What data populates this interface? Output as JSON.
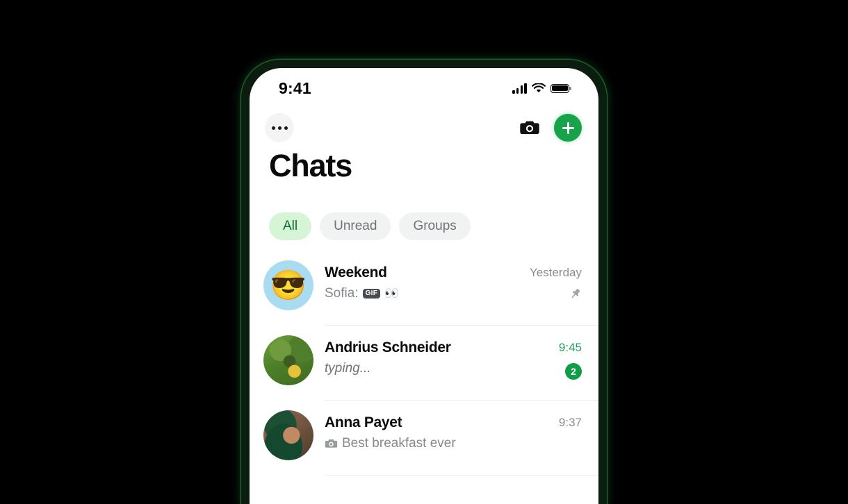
{
  "status_bar": {
    "time": "9:41",
    "signal_icon": "cellular-signal-icon",
    "wifi_icon": "wifi-icon",
    "battery_icon": "battery-full-icon"
  },
  "top_bar": {
    "menu_label": "•••",
    "menu_icon": "more-options-icon",
    "camera_icon": "camera-icon",
    "add_icon": "plus-icon"
  },
  "page": {
    "title": "Chats"
  },
  "filters": [
    {
      "label": "All",
      "active": true
    },
    {
      "label": "Unread",
      "active": false
    },
    {
      "label": "Groups",
      "active": false
    }
  ],
  "chats": [
    {
      "name": "Weekend",
      "avatar_type": "emoji",
      "avatar_emoji": "😎",
      "preview_sender": "Sofia:",
      "preview_badge": "GIF",
      "preview_emoji": "👀",
      "preview_text": "",
      "time": "Yesterday",
      "time_unread": false,
      "pinned": true,
      "pin_icon": "pin-icon",
      "unread_count": ""
    },
    {
      "name": "Andrius Schneider",
      "avatar_type": "photo-green",
      "avatar_emoji": "",
      "preview_sender": "",
      "preview_badge": "",
      "preview_emoji": "",
      "preview_text": "typing...",
      "time": "9:45",
      "time_unread": true,
      "pinned": false,
      "pin_icon": "",
      "unread_count": "2"
    },
    {
      "name": "Anna Payet",
      "avatar_type": "photo-portrait",
      "avatar_emoji": "",
      "preview_sender": "",
      "preview_badge": "",
      "preview_emoji": "",
      "preview_text": "Best breakfast ever",
      "preview_icon": "camera-icon",
      "time": "9:37",
      "time_unread": false,
      "pinned": false,
      "pin_icon": "",
      "unread_count": ""
    }
  ],
  "colors": {
    "brand_green": "#17a34a",
    "badge_green": "#0f9d47",
    "unread_time_green": "#23a15c",
    "pill_active_bg": "#d6f5d6",
    "pill_active_text": "#0f6b36",
    "pill_bg": "#f1f2f2",
    "background": "#000000",
    "frame_outline": "#1f5c2e"
  }
}
